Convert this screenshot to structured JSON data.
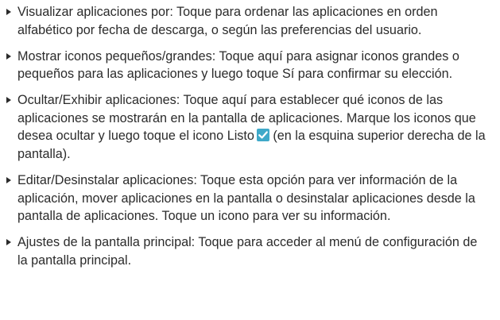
{
  "items": [
    {
      "term": "Visualizar aplicaciones por",
      "text": ": Toque para ordenar las aplicaciones en orden alfabético por fecha de descarga, o según las preferencias del usuario."
    },
    {
      "term": "Mostrar iconos pequeños/grandes",
      "text_before": ": Toque aquí para asignar iconos grandes o pequeños para las aplicaciones y luego toque ",
      "inline": "Sí",
      "text_after": " para confirmar su elección."
    },
    {
      "term": "Ocultar/Exhibir aplicaciones",
      "text_before": ": Toque aquí para establecer qué iconos de las aplicaciones se mostrarán en la pantalla de aplicaciones. Marque los iconos que desea ocultar y luego toque el icono ",
      "inline": "Listo",
      "icon": "checkmark-icon",
      "text_after": " (en la esquina superior derecha de la pantalla)."
    },
    {
      "term": "Editar/Desinstalar aplicaciones",
      "text": ": Toque esta opción para ver información de la aplicación, mover aplicaciones en la pantalla o desinstalar aplicaciones desde la pantalla de aplicaciones. Toque un icono para ver su información."
    },
    {
      "term": "Ajustes de la pantalla principal",
      "text": ": Toque para acceder al menú de configuración de la pantalla principal."
    }
  ],
  "colors": {
    "text": "#2b2b2b",
    "icon_bg": "#3fa9c9",
    "icon_check": "#ffffff"
  }
}
